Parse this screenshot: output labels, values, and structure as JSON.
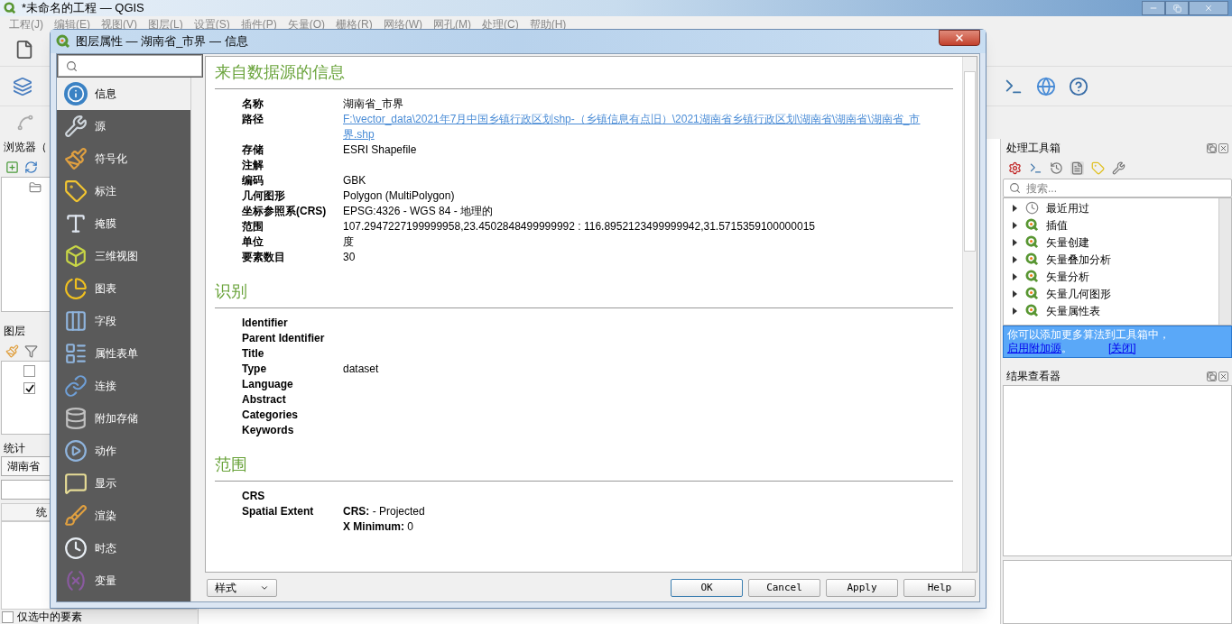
{
  "app": {
    "title": "*未命名的工程 — QGIS",
    "menu": [
      "工程(J)",
      "编辑(E)",
      "视图(V)",
      "图层(L)",
      "设置(S)",
      "插件(P)",
      "矢量(O)",
      "栅格(R)",
      "网络(W)",
      "网孔(M)",
      "处理(C)",
      "帮助(H)"
    ]
  },
  "browser_panel": {
    "title": "浏览器（"
  },
  "layers_panel": {
    "title": "图层",
    "layers": [
      {
        "checked": false
      },
      {
        "checked": true
      }
    ]
  },
  "statistics_panel": {
    "title": "统计",
    "layer": "湖南省",
    "column_1": "统",
    "option": "仅选中的要素",
    "option_checked": false
  },
  "dialog": {
    "title": "图层属性 — 湖南省_市界 — 信息",
    "nav": [
      {
        "label": "信息",
        "selected": true
      },
      {
        "label": "源",
        "selected": false
      },
      {
        "label": "符号化",
        "selected": false
      },
      {
        "label": "标注",
        "selected": false
      },
      {
        "label": "掩膜",
        "selected": false
      },
      {
        "label": "三维视图",
        "selected": false
      },
      {
        "label": "图表",
        "selected": false
      },
      {
        "label": "字段",
        "selected": false
      },
      {
        "label": "属性表单",
        "selected": false
      },
      {
        "label": "连接",
        "selected": false
      },
      {
        "label": "附加存储",
        "selected": false
      },
      {
        "label": "动作",
        "selected": false
      },
      {
        "label": "显示",
        "selected": false
      },
      {
        "label": "渲染",
        "selected": false
      },
      {
        "label": "时态",
        "selected": false
      },
      {
        "label": "变量",
        "selected": false
      }
    ],
    "sections": [
      {
        "title": "来自数据源的信息",
        "rows": [
          {
            "label": "名称",
            "value": "湖南省_市界",
            "kind": "text"
          },
          {
            "label": "路径",
            "value": "F:\\vector_data\\2021年7月中国乡镇行政区划shp-（乡镇信息有点旧）\\2021湖南省乡镇行政区划\\湖南省\\湖南省\\湖南省_市界.shp",
            "kind": "link"
          },
          {
            "label": "存储",
            "value": "ESRI Shapefile",
            "kind": "text"
          },
          {
            "label": "注解",
            "kind": "text"
          },
          {
            "label": "编码",
            "value": "GBK",
            "kind": "text"
          },
          {
            "label": "几何图形",
            "value": "Polygon (MultiPolygon)",
            "kind": "text"
          },
          {
            "label": "坐标参照系(CRS)",
            "value": "EPSG:4326 - WGS 84 - 地理的",
            "kind": "text"
          },
          {
            "label": "范围",
            "value": "107.2947227199999958,23.4502848499999992 : 116.8952123499999942,31.5715359100000015",
            "kind": "text"
          },
          {
            "label": "单位",
            "value": "度",
            "kind": "text"
          },
          {
            "label": "要素数目",
            "value": "30",
            "kind": "text"
          }
        ]
      },
      {
        "title": "识别",
        "rows": [
          {
            "label": "Identifier",
            "kind": "text"
          },
          {
            "label": "Parent Identifier",
            "kind": "text"
          },
          {
            "label": "Title",
            "kind": "text"
          },
          {
            "label": "Type",
            "value": "dataset",
            "kind": "text"
          },
          {
            "label": "Language",
            "kind": "text"
          },
          {
            "label": "Abstract",
            "kind": "text"
          },
          {
            "label": "Categories",
            "kind": "text"
          },
          {
            "label": "Keywords",
            "kind": "text"
          }
        ]
      },
      {
        "title": "范围",
        "rows": [
          {
            "label": "CRS",
            "kind": "text"
          },
          {
            "label": "Spatial Extent",
            "lines": [
              "**CRS:** - Projected",
              "**X Minimum:** 0"
            ],
            "kind": "lines"
          }
        ]
      }
    ],
    "style_button": "样式",
    "buttons": [
      "OK",
      "Cancel",
      "Apply",
      "Help"
    ]
  },
  "processing": {
    "title": "处理工具箱",
    "search_placeholder": "搜索...",
    "groups": [
      {
        "label": "最近用过",
        "kind": "history",
        "expanded": false
      },
      {
        "label": "插值",
        "kind": "provider",
        "expanded": false
      },
      {
        "label": "矢量创建",
        "kind": "provider",
        "expanded": false
      },
      {
        "label": "矢量叠加分析",
        "kind": "provider",
        "expanded": false
      },
      {
        "label": "矢量分析",
        "kind": "provider",
        "expanded": false
      },
      {
        "label": "矢量几何图形",
        "kind": "provider",
        "expanded": false
      },
      {
        "label": "矢量属性表",
        "kind": "provider",
        "expanded": false
      }
    ],
    "notice": {
      "text": "你可以添加更多算法到工具箱中，",
      "link": "启用附加源",
      "suffix": "。",
      "close": "[关闭]"
    }
  },
  "results": {
    "title": "结果查看器"
  }
}
